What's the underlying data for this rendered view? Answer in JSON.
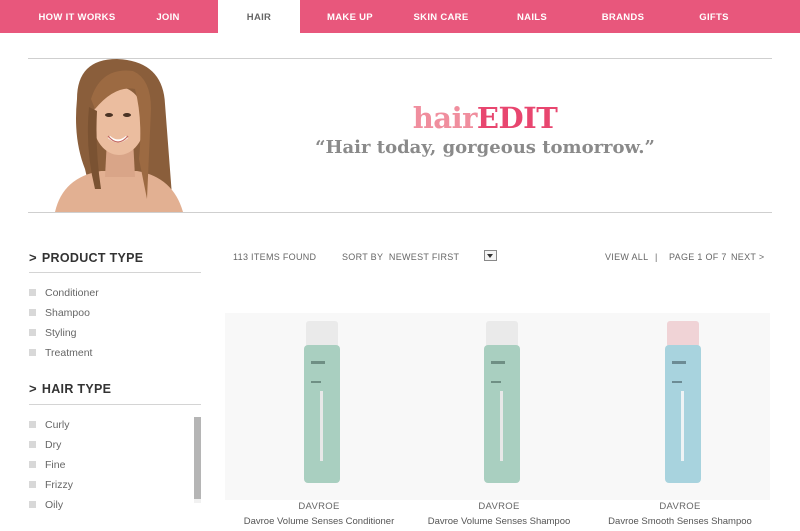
{
  "nav": {
    "items": [
      {
        "label": "HOW IT WORKS",
        "active": false
      },
      {
        "label": "JOIN",
        "active": false
      },
      {
        "label": "HAIR",
        "active": true
      },
      {
        "label": "MAKE UP",
        "active": false
      },
      {
        "label": "SKIN CARE",
        "active": false
      },
      {
        "label": "NAILS",
        "active": false
      },
      {
        "label": "BRANDS",
        "active": false
      },
      {
        "label": "GIFTS",
        "active": false
      }
    ]
  },
  "hero": {
    "brand_light": "hair",
    "brand_bold": "EDIT",
    "tagline": "“Hair today, gorgeous tomorrow.”"
  },
  "sidebar": {
    "product_type": {
      "heading": "PRODUCT TYPE",
      "items": [
        "Conditioner",
        "Shampoo",
        "Styling",
        "Treatment"
      ]
    },
    "hair_type": {
      "heading": "HAIR TYPE",
      "items": [
        "Curly",
        "Dry",
        "Fine",
        "Frizzy",
        "Oily"
      ]
    }
  },
  "toolbar": {
    "count": "113 ITEMS FOUND",
    "sort_prefix": "SORT BY",
    "sort_value": "NEWEST FIRST",
    "view_all": "VIEW ALL",
    "separator": "|",
    "page_info": "PAGE 1 OF 7",
    "next": "NEXT >"
  },
  "products": [
    {
      "brand": "DAVROE",
      "name": "Davroe Volume Senses Conditioner",
      "bottle_color": "#a9cfc0"
    },
    {
      "brand": "DAVROE",
      "name": "Davroe Volume Senses Shampoo",
      "bottle_color": "#a9cfc0"
    },
    {
      "brand": "DAVROE",
      "name": "Davroe Smooth Senses Shampoo",
      "bottle_color": "#a8d3de"
    }
  ],
  "colors": {
    "nav_pink": "#e8577c",
    "brand_light": "#f08e9e",
    "brand_bold": "#e8466f"
  }
}
